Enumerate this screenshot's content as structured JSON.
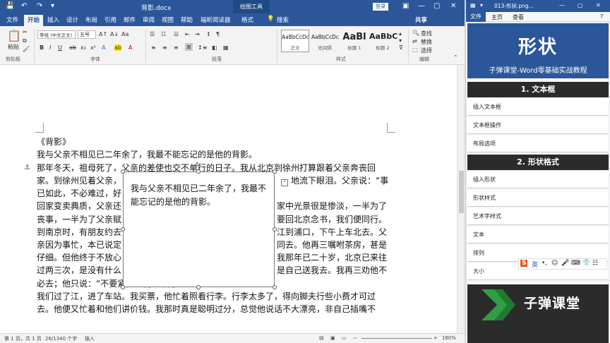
{
  "word": {
    "title": "背影.docx",
    "drawing_tools": "绘图工具",
    "login": "登录",
    "window_buttons": [
      "—",
      "▢",
      "✕"
    ],
    "tabs": [
      "文件",
      "开始",
      "插入",
      "设计",
      "布局",
      "引用",
      "邮件",
      "审阅",
      "视图",
      "帮助",
      "福昕阅读器",
      "格式"
    ],
    "search": "搜索",
    "share": "共享",
    "ribbon": {
      "paste": "粘贴",
      "font_name": "等线 (中文正文)",
      "font_size": "五号",
      "clipboard_label": "剪贴板",
      "font_label": "字体",
      "paragraph_label": "段落",
      "styles_label": "样式",
      "editing_label": "编辑",
      "styles": [
        {
          "preview": "AaBbCcDc",
          "name": "正文"
        },
        {
          "preview": "AaBbCcDc",
          "name": "无间隔"
        },
        {
          "preview": "AaBl",
          "name": "标题 1"
        },
        {
          "preview": "AaBbC",
          "name": "标题 2"
        }
      ],
      "find": "查找",
      "replace": "替换",
      "select": "选择"
    },
    "document": {
      "lines": [
        "《背影》",
        "我与父亲不相见已二年余了，我最不能忘记的是他的背影。",
        "那年冬天，祖母死了，父亲的差使也交不单行的日子。我从北京到徐州打算跟着父亲奔丧回",
        "家。到徐州见着父亲，",
        "已如此，不必难过，好",
        "回家变卖典质，父亲还",
        "丧事，一半为了父亲赋",
        "到南京时，有朋友约去",
        "亲因为事忙，本已说定",
        "仔细。但他终于不放心",
        "过两三次，是没有什么",
        "必去；他只说：“不要紧，他们去不好！”",
        "我们过了江，进了车站。我买票，他忙着照看行李。行李太多了，得向脚夫行些小费才可过",
        "去。他便又忙着和他们讲价钱。我那时真是聪明过分，总觉他说话不大漂亮，非自己插嘴不"
      ],
      "right_fragments": [
        "地流下眼泪。父亲说：“事",
        "家中光景很是惨淡，一半为了",
        "要回北京念书，我们便同行。",
        "江到浦口，下午上车北去。父",
        "同去。他再三嘱咐茶房，甚是",
        "我那年已二十岁，北京已来往",
        "是自己送我去。我再三劝他不"
      ],
      "textbox_lines": [
        "我与父亲不相见已二年余了，我最不",
        "能忘记的是他的背影。"
      ]
    },
    "status": {
      "page": "第 1 页，共 1 页",
      "words": "26/1340 个字",
      "mode": "插入",
      "zoom": "160%"
    }
  },
  "viewer": {
    "filename": "013-形状.png...",
    "tabs": [
      "文件",
      "主页",
      "查看"
    ],
    "course": {
      "title": "形状",
      "subtitle": "子弹课堂-Word零基础实战教程",
      "sections": [
        {
          "heading": "1. 文本框",
          "items": [
            "插入文本框",
            "文本框操作",
            "布局选项"
          ]
        },
        {
          "heading": "2. 形状格式",
          "items": [
            "插入形状",
            "形状样式",
            "艺术字样式",
            "文本",
            "排列",
            "大小"
          ]
        }
      ],
      "brand": "子弹课堂"
    },
    "ime_label": "英"
  }
}
